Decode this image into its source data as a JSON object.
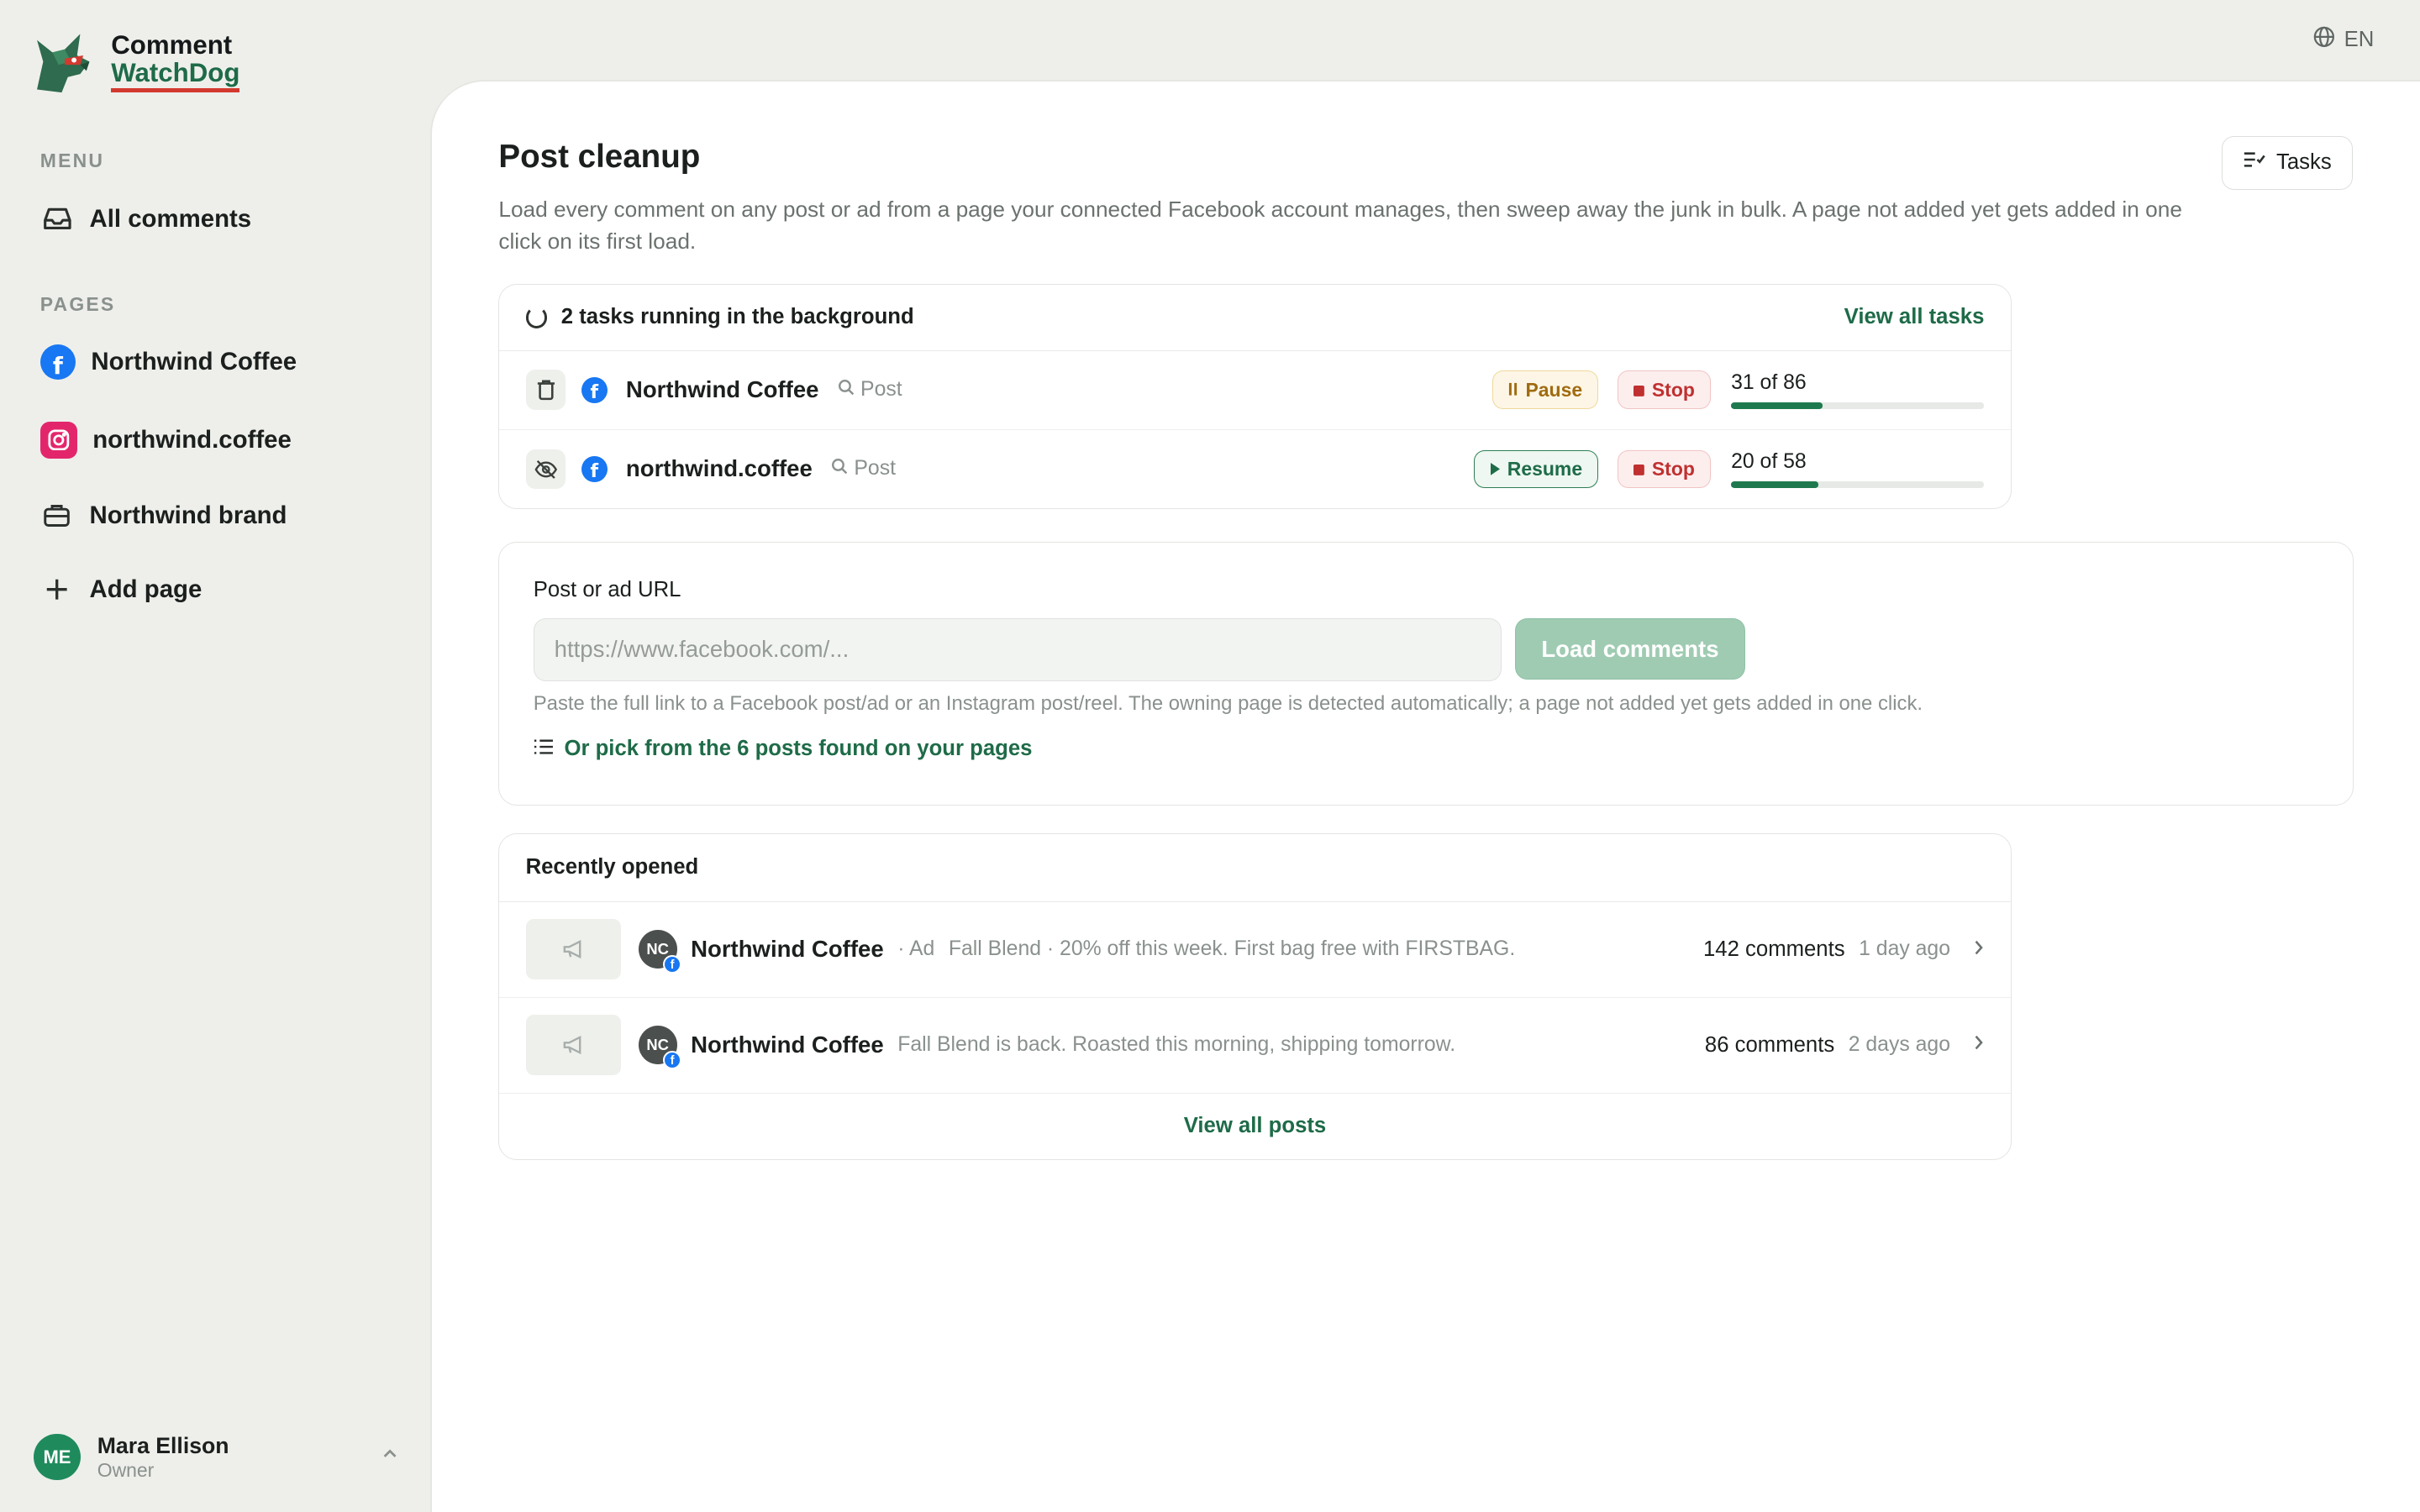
{
  "app": {
    "brand_line1": "Comment",
    "brand_line2": "WatchDog",
    "language": "EN"
  },
  "sidebar": {
    "menu_label": "MENU",
    "menu_items": [
      {
        "label": "All comments",
        "icon": "inbox-icon"
      }
    ],
    "pages_label": "PAGES",
    "pages": [
      {
        "label": "Northwind Coffee",
        "icon": "facebook-icon"
      },
      {
        "label": "northwind.coffee",
        "icon": "instagram-icon"
      },
      {
        "label": "Northwind brand",
        "icon": "briefcase-icon"
      }
    ],
    "add_page": "Add page",
    "user": {
      "initials": "ME",
      "name": "Mara Ellison",
      "role": "Owner"
    }
  },
  "main": {
    "title": "Post cleanup",
    "description": "Load every comment on any post or ad from a page your connected Facebook account manages, then sweep away the junk in bulk. A page not added yet gets added in one click on its first load.",
    "tasks_button": "Tasks"
  },
  "background_tasks": {
    "heading": "2 tasks running in the background",
    "view_all": "View all tasks",
    "tasks": [
      {
        "name": "Northwind Coffee",
        "kind": "Post",
        "action": "Pause",
        "stop": "Stop",
        "done": 31,
        "total": 86,
        "progress_text": "31 of 86",
        "status_icon": "trash-icon"
      },
      {
        "name": "northwind.coffee",
        "kind": "Post",
        "action": "Resume",
        "stop": "Stop",
        "done": 20,
        "total": 58,
        "progress_text": "20 of 58",
        "status_icon": "eye-off-icon"
      }
    ]
  },
  "url_form": {
    "label": "Post or ad URL",
    "placeholder": "https://www.facebook.com/...",
    "value": "",
    "button": "Load comments",
    "help": "Paste the full link to a Facebook post/ad or an Instagram post/reel. The owning page is detected automatically; a page not added yet gets added in one click.",
    "pick_link": "Or pick from the 6 posts found on your pages"
  },
  "recent": {
    "heading": "Recently opened",
    "items": [
      {
        "avatar": "NC",
        "name": "Northwind Coffee",
        "meta": "· Ad",
        "text": "Fall Blend · 20% off this week. First bag free with FIRSTBAG.",
        "count": "142 comments",
        "time": "1 day ago"
      },
      {
        "avatar": "NC",
        "name": "Northwind Coffee",
        "meta": "",
        "text": "Fall Blend is back. Roasted this morning, shipping tomorrow.",
        "count": "86 comments",
        "time": "2 days ago"
      }
    ],
    "view_all": "View all posts"
  },
  "colors": {
    "accent": "#1e6b48",
    "facebook": "#1877f2",
    "instagram": "#e3266b",
    "stop": "#c03030",
    "pause": "#a06b10"
  }
}
